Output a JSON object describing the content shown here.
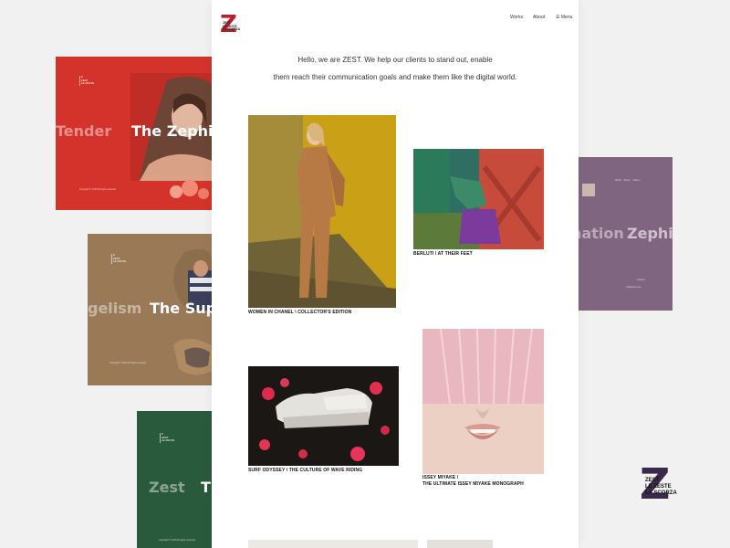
{
  "logo": {
    "letter": "Z",
    "lines": [
      "ZEST",
      "LE ZESTE",
      "LA SCORZA"
    ]
  },
  "nav": {
    "works": "Works",
    "about": "About",
    "menu": "Menu"
  },
  "intro": {
    "line1": "Hello, we are ZEST. We help our clients to stand out, enable",
    "line2": "them reach their communication goals and make them like the digital world."
  },
  "works": [
    {
      "caption": "WOMEN IN CHANEL \\ COLLECTOR'S EDITION"
    },
    {
      "caption": "BERLUTI \\ AT THEIR FEET"
    },
    {
      "caption": "SURF ODYSSEY \\ THE CULTURE OF WAVE RIDING"
    },
    {
      "caption_line1": "ISSEY MIYAKE \\",
      "caption_line2": "THE ULTIMATE ISSEY MIYAKE MONOGRAPH"
    }
  ],
  "cards": {
    "red": {
      "dim_word": "Tender",
      "title": "The Zephir",
      "color": "#d3332b"
    },
    "brown": {
      "dim_word": "gelism",
      "title": "The Supe",
      "color": "#9a7956"
    },
    "green": {
      "dim_word": "Zest",
      "title": "T",
      "color": "#2a5a3c"
    },
    "purple": {
      "dim_word": "nation",
      "title": "Zephi",
      "color": "#7f6580"
    }
  },
  "badge": {
    "letter": "Z",
    "lines": [
      "ZEST",
      "LE ZESTE",
      "LA SCORZA"
    ]
  }
}
